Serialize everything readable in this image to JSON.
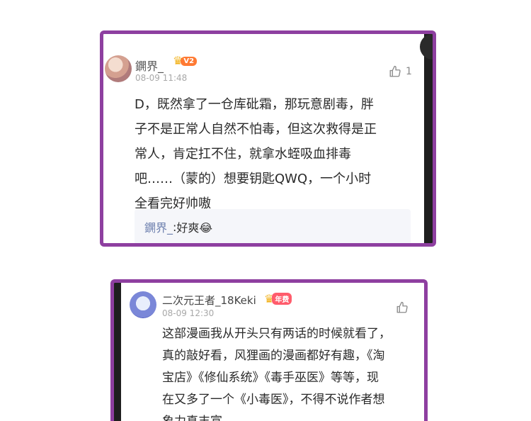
{
  "comments": [
    {
      "username": "鐦界_",
      "level": "V2",
      "timestamp": "08-09 11:48",
      "like_count": "1",
      "text": "D，既然拿了一仓库砒霜，那玩意剧毒，胖\n子不是正常人自然不怕毒，但这次救得是正\n常人，肯定扛不住，就拿水蛭吸血排毒\n吧……（蒙的）想要钥匙QWQ，一个小时\n全看完好帅嗷",
      "reply": {
        "name": "鐦界_",
        "separator": ": ",
        "text": "好爽😂"
      }
    },
    {
      "username": "二次元王者_18Keki",
      "level": "年费",
      "timestamp": "08-09 12:30",
      "like_count": "",
      "text": "这部漫画我从开头只有两话的时候就看了，\n真的敲好看，风狸画的漫画都好有趣，《淘\n宝店》《修仙系统》《毒手巫医》等等，现\n在又多了一个《小毒医》，不得不说作者想\n象力真丰富"
    }
  ],
  "icons": {
    "like": "thumbs-up-icon",
    "crown": "crown-icon"
  },
  "colors": {
    "card_border": "#8e3fa0",
    "badge_v2": "#ff7a33",
    "badge_annual": "#ff5c6c"
  }
}
